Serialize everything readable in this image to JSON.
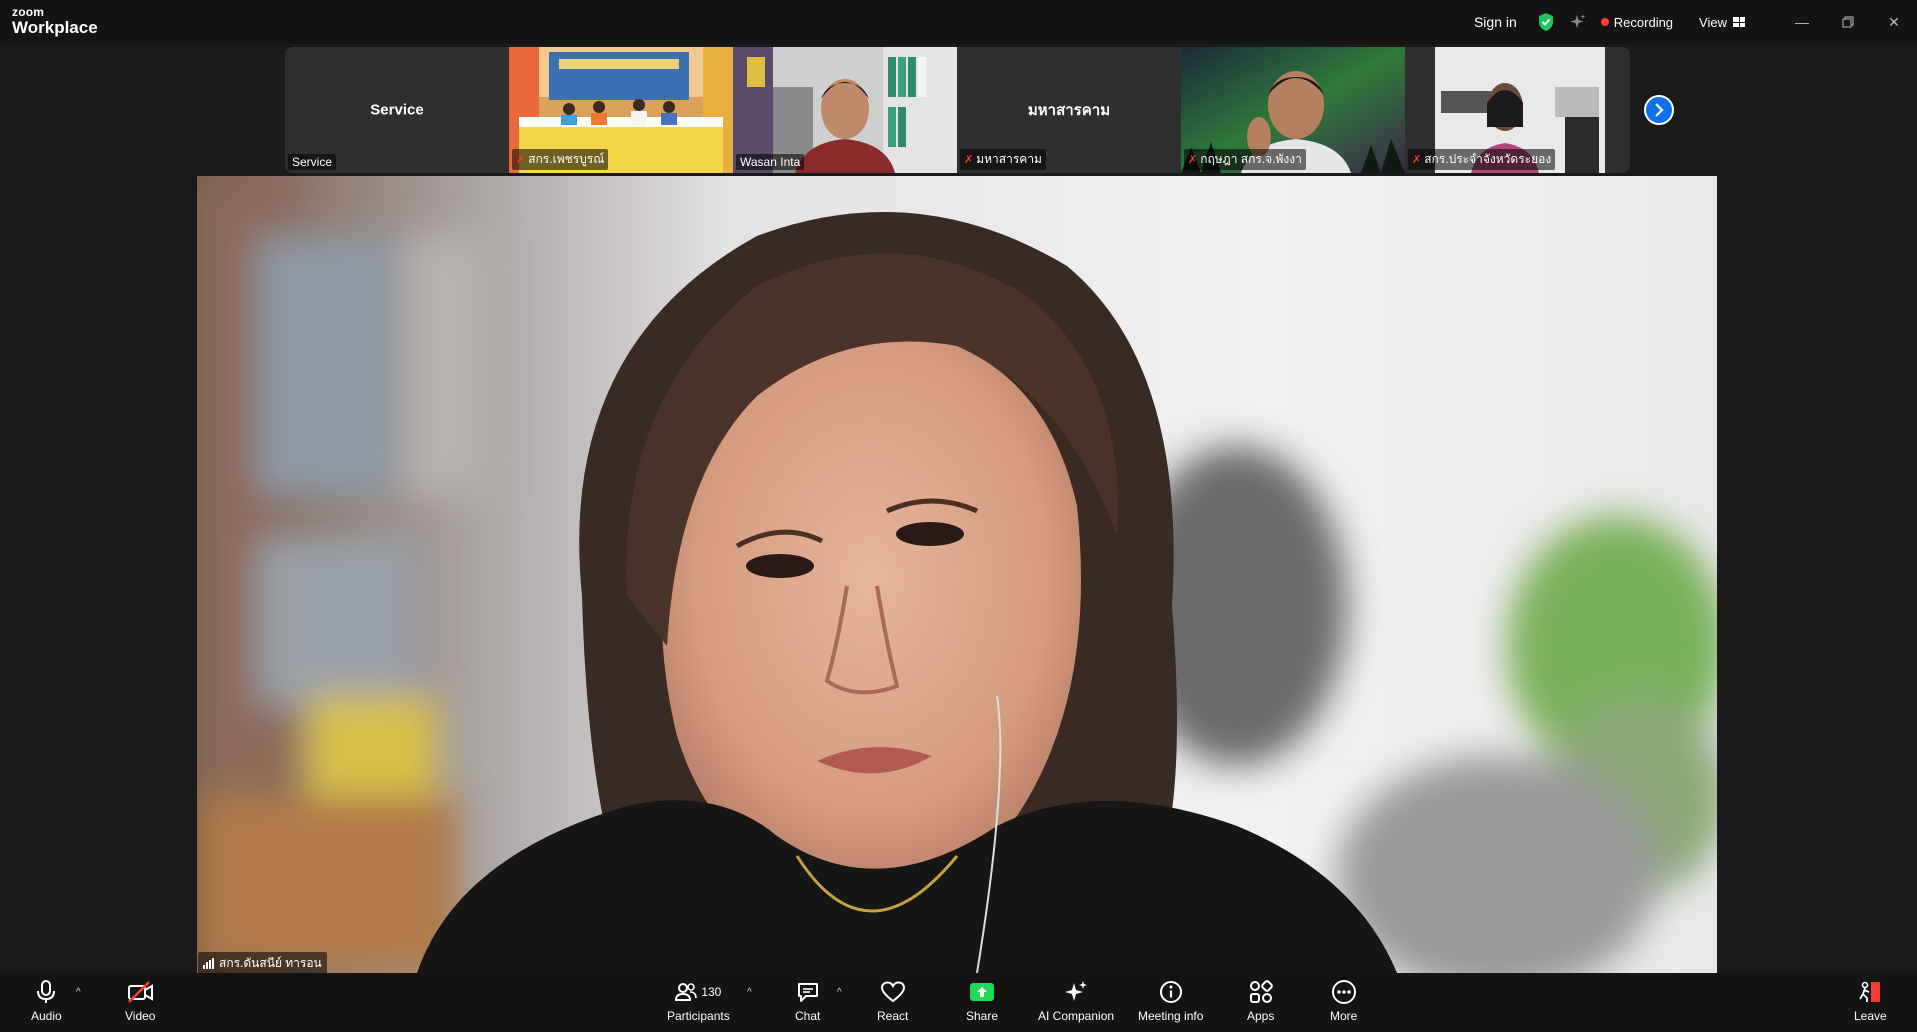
{
  "app": {
    "logo_top": "zoom",
    "logo_bottom": "Workplace"
  },
  "titlebar": {
    "sign_in": "Sign in",
    "recording": "Recording",
    "view": "View"
  },
  "filmstrip": {
    "tiles": [
      {
        "center_name": "Service",
        "nameplate": "Service",
        "muted": false,
        "type": "avatar"
      },
      {
        "center_name": "",
        "nameplate": "สกร.เพชรบูรณ์",
        "muted": true,
        "type": "video"
      },
      {
        "center_name": "",
        "nameplate": "Wasan Inta",
        "muted": false,
        "type": "video"
      },
      {
        "center_name": "มหาสารคาม",
        "nameplate": "มหาสารคาม",
        "muted": true,
        "type": "avatar"
      },
      {
        "center_name": "",
        "nameplate": "กฤษฎา สกร.จ.พังงา",
        "muted": true,
        "type": "video"
      },
      {
        "center_name": "",
        "nameplate": "สกร.ประจำจังหวัดระยอง",
        "muted": true,
        "type": "video"
      }
    ]
  },
  "main_speaker": {
    "name": "สกร.ดันสนีย์ ทารอน"
  },
  "toolbar": {
    "audio": "Audio",
    "video": "Video",
    "participants": "Participants",
    "participants_count": "130",
    "chat": "Chat",
    "react": "React",
    "share": "Share",
    "ai_companion": "AI Companion",
    "meeting_info": "Meeting info",
    "apps": "Apps",
    "more": "More",
    "leave": "Leave"
  },
  "colors": {
    "accent_blue": "#0e72ed",
    "share_green": "#23d959",
    "danger_red": "#ff3b30",
    "shield_green": "#21c55d"
  }
}
